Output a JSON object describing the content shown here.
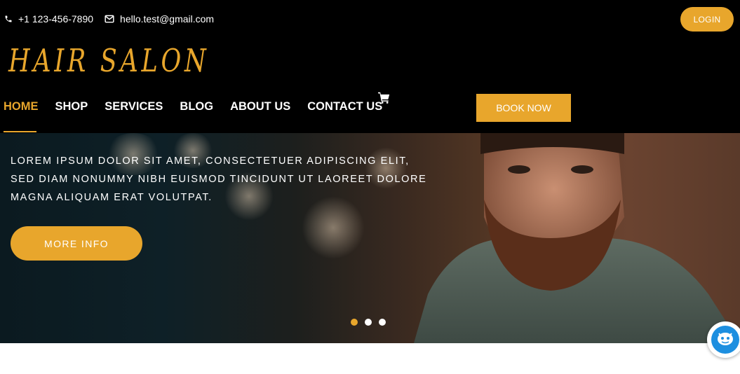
{
  "topbar": {
    "phone": "+1 123-456-7890",
    "phone_icon": "phone-icon",
    "email": "hello.test@gmail.com",
    "email_icon": "envelope-icon",
    "login_label": "LOGIN"
  },
  "brand": {
    "logo_text": "HAIR SALON"
  },
  "nav": {
    "items": [
      {
        "label": "HOME",
        "active": true
      },
      {
        "label": "SHOP"
      },
      {
        "label": "SERVICES"
      },
      {
        "label": "BLOG"
      },
      {
        "label": "ABOUT US"
      },
      {
        "label": "CONTACT US"
      }
    ],
    "cart_icon": "shopping-cart-icon",
    "book_label": "BOOK NOW"
  },
  "hero": {
    "text": "LOREM IPSUM DOLOR SIT AMET, CONSECTETUER ADIPISCING ELIT, SED DIAM NONUMMY NIBH EUISMOD TINCIDUNT UT LAOREET DOLORE MAGNA ALIQUAM ERAT VOLUTPAT.",
    "button_label": "MORE INFO",
    "slides": 3,
    "active_slide": 1
  },
  "colors": {
    "accent": "#e8a62c",
    "header_bg": "#000000",
    "text_light": "#ffffff"
  },
  "widget": {
    "icon": "chat-bot-icon"
  }
}
